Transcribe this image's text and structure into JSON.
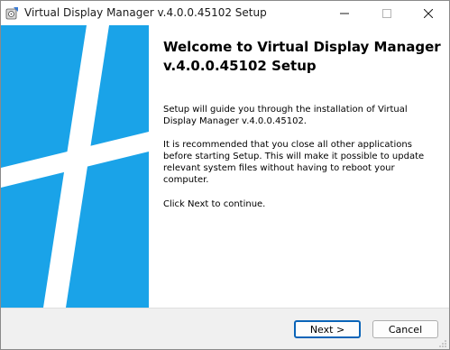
{
  "window": {
    "title": "Virtual Display Manager v.4.0.0.45102 Setup",
    "icon": "installer-icon",
    "controls": {
      "minimize_label": "—",
      "maximize_label": "☐",
      "close_label": "✕"
    }
  },
  "banner": {
    "color": "#1aa3e8",
    "graphic": "windows-logo-icon"
  },
  "main": {
    "heading": "Welcome to Virtual Display Manager v.4.0.0.45102 Setup",
    "paragraphs": [
      "Setup will guide you through the installation of Virtual Display Manager v.4.0.0.45102.",
      "It is recommended that you close all other applications before starting Setup. This will make it possible to update relevant system files without having to reboot your computer.",
      "Click Next to continue."
    ]
  },
  "footer": {
    "next_label": "Next >",
    "cancel_label": "Cancel"
  },
  "colors": {
    "accent": "#1aa3e8",
    "default_button_border": "#0a64b8"
  }
}
